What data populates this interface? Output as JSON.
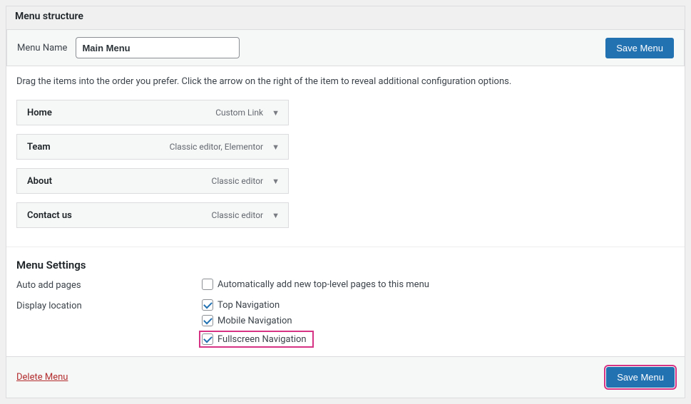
{
  "header": {
    "title": "Menu structure"
  },
  "name_row": {
    "label": "Menu Name",
    "value": "Main Menu",
    "save_label": "Save Menu"
  },
  "instructions": "Drag the items into the order you prefer. Click the arrow on the right of the item to reveal additional configuration options.",
  "items": [
    {
      "title": "Home",
      "type": "Custom Link"
    },
    {
      "title": "Team",
      "type": "Classic editor, Elementor"
    },
    {
      "title": "About",
      "type": "Classic editor"
    },
    {
      "title": "Contact us",
      "type": "Classic editor"
    }
  ],
  "settings": {
    "title": "Menu Settings",
    "auto_add": {
      "label": "Auto add pages",
      "option": "Automatically add new top-level pages to this menu",
      "checked": false
    },
    "display": {
      "label": "Display location",
      "options": [
        {
          "label": "Top Navigation",
          "checked": true,
          "highlighted": false
        },
        {
          "label": "Mobile Navigation",
          "checked": true,
          "highlighted": false
        },
        {
          "label": "Fullscreen Navigation",
          "checked": true,
          "highlighted": true
        }
      ]
    }
  },
  "footer": {
    "delete_label": "Delete Menu",
    "save_label": "Save Menu"
  }
}
